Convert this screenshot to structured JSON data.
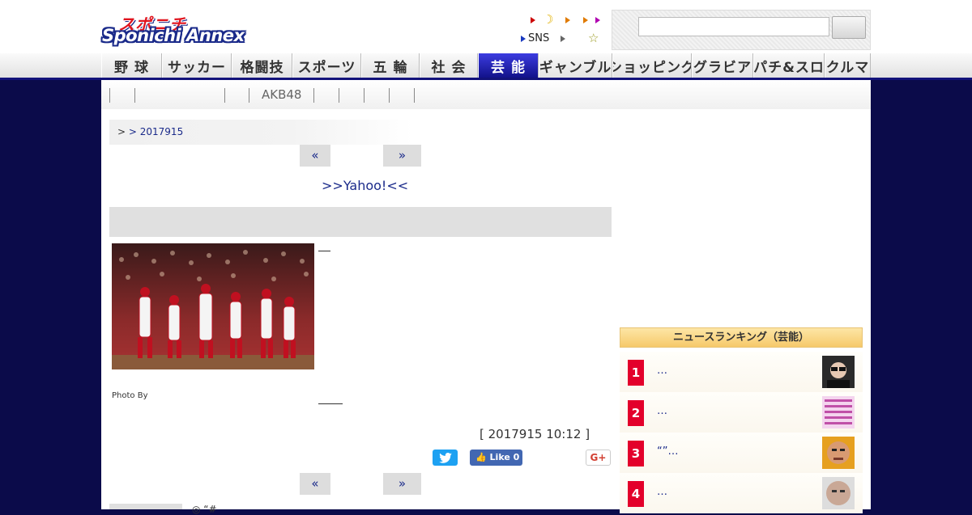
{
  "header": {
    "logo_top": "スポニチ",
    "logo_main": "Sponichi Annex",
    "sns_label": "SNS",
    "search_placeholder": "",
    "search_button": ""
  },
  "nav": {
    "items": [
      {
        "label": "野 球",
        "active": false
      },
      {
        "label": "サッカー",
        "active": false
      },
      {
        "label": "格闘技",
        "active": false
      },
      {
        "label": "スポーツ",
        "active": false
      },
      {
        "label": "五 輪",
        "active": false
      },
      {
        "label": "社 会",
        "active": false
      },
      {
        "label": "芸 能",
        "active": true
      },
      {
        "label": "ギャンブル",
        "active": false
      },
      {
        "label": "ショッピング",
        "active": false
      },
      {
        "label": "グラビア",
        "active": false
      },
      {
        "label": "パチ&スロ",
        "active": false
      },
      {
        "label": "クルマ",
        "active": false
      }
    ]
  },
  "subnav": {
    "akb_label": "AKB48"
  },
  "breadcrumb": {
    "prefix": ">",
    "link": "> 2017915"
  },
  "pager": {
    "prev": "«",
    "next": "»"
  },
  "yahoo_link": ">>Yahoo!<<",
  "article": {
    "photo_caption": "Photo By",
    "date": "[ 2017915 10:12 ]"
  },
  "share": {
    "twitter_glyph": "t",
    "fb_label": "Like 0",
    "gplus_label": "G+"
  },
  "ranking": {
    "header": "ニュースランキング（芸能）",
    "items": [
      {
        "rank": "1",
        "text": "…"
      },
      {
        "rank": "2",
        "text": "…"
      },
      {
        "rank": "3",
        "text": "“”…"
      },
      {
        "rank": "4",
        "text": "…"
      }
    ]
  },
  "bottom": {
    "text": "◎ “#"
  },
  "colors": {
    "accent_navy": "#12127a",
    "page_bg": "#0b0b4a",
    "rank_red": "#e3002b"
  }
}
